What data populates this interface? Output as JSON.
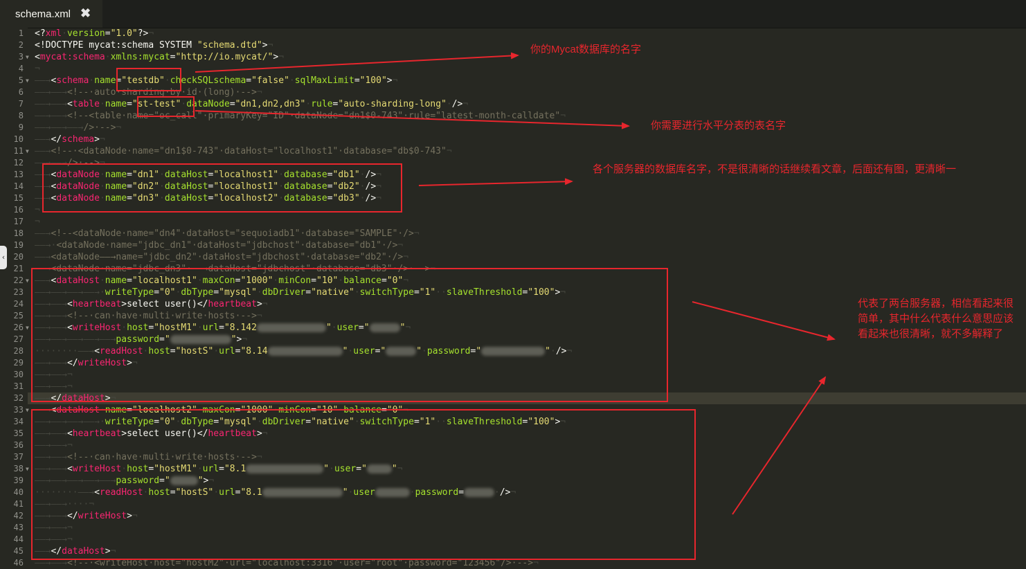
{
  "tab": {
    "title": "schema.xml",
    "close": "✖"
  },
  "colors": {
    "tag": "#f92672",
    "attr": "#a6e22e",
    "string": "#e6db74",
    "comment": "#75715e",
    "annotation": "#e8262d"
  },
  "code": [
    [
      [
        "p",
        "<?"
      ],
      [
        "t",
        "xml"
      ],
      [
        "w",
        "·"
      ],
      [
        "a",
        "version"
      ],
      [
        "p",
        "="
      ],
      [
        "s",
        "\"1.0\""
      ],
      [
        "p",
        "?>"
      ],
      [
        "w",
        "¬"
      ]
    ],
    [
      [
        "p",
        "<!DOCTYPE mycat:schema SYSTEM "
      ],
      [
        "s",
        "\"schema.dtd\""
      ],
      [
        "p",
        ">"
      ],
      [
        "w",
        "¬"
      ]
    ],
    [
      [
        "p",
        "<"
      ],
      [
        "t",
        "mycat:schema"
      ],
      [
        "w",
        "·"
      ],
      [
        "a",
        "xmlns:mycat"
      ],
      [
        "p",
        "="
      ],
      [
        "s",
        "\"http://io.mycat/\""
      ],
      [
        "p",
        ">"
      ],
      [
        "w",
        "¬"
      ]
    ],
    [
      [
        "w",
        "¬"
      ]
    ],
    [
      [
        "w",
        "——→"
      ],
      [
        "p",
        "<"
      ],
      [
        "t",
        "schema"
      ],
      [
        "w",
        "·"
      ],
      [
        "a",
        "name"
      ],
      [
        "p",
        "="
      ],
      [
        "s",
        "\"testdb\""
      ],
      [
        "w",
        "·"
      ],
      [
        "a",
        "checkSQLschema"
      ],
      [
        "p",
        "="
      ],
      [
        "s",
        "\"false\""
      ],
      [
        "w",
        "·"
      ],
      [
        "a",
        "sqlMaxLimit"
      ],
      [
        "p",
        "="
      ],
      [
        "s",
        "\"100\""
      ],
      [
        "p",
        ">"
      ],
      [
        "w",
        "¬"
      ]
    ],
    [
      [
        "w",
        "——→——→"
      ],
      [
        "c",
        "<!--·auto·sharding·by·id·(long)·-->"
      ],
      [
        "w",
        "¬"
      ]
    ],
    [
      [
        "w",
        "——→——→"
      ],
      [
        "p",
        "<"
      ],
      [
        "t",
        "table"
      ],
      [
        "w",
        "·"
      ],
      [
        "a",
        "name"
      ],
      [
        "p",
        "="
      ],
      [
        "s",
        "\"st-test\""
      ],
      [
        "w",
        "·"
      ],
      [
        "a",
        "dataNode"
      ],
      [
        "p",
        "="
      ],
      [
        "s",
        "\"dn1,dn2,dn3\""
      ],
      [
        "w",
        "·"
      ],
      [
        "a",
        "rule"
      ],
      [
        "p",
        "="
      ],
      [
        "s",
        "\"auto-sharding-long\""
      ],
      [
        "w",
        "·"
      ],
      [
        "p",
        "/>"
      ],
      [
        "w",
        "¬"
      ]
    ],
    [
      [
        "w",
        "——→——→"
      ],
      [
        "c",
        "<!--<table·name=\"oc_call\"·primaryKey=\"ID\"·dataNode=\"dn1$0-743\"·rule=\"latest-month-calldate\""
      ],
      [
        "w",
        "¬"
      ]
    ],
    [
      [
        "w",
        "——→——→——→"
      ],
      [
        "c",
        "/>·-->"
      ],
      [
        "w",
        "¬"
      ]
    ],
    [
      [
        "w",
        "——→"
      ],
      [
        "p",
        "</"
      ],
      [
        "t",
        "schema"
      ],
      [
        "p",
        ">"
      ],
      [
        "w",
        "¬"
      ]
    ],
    [
      [
        "w",
        "——→"
      ],
      [
        "c",
        "<!--·<dataNode·name=\"dn1$0-743\"·dataHost=\"localhost1\"·database=\"db$0-743\""
      ],
      [
        "w",
        "¬"
      ]
    ],
    [
      [
        "w",
        "——→——→"
      ],
      [
        "c",
        "/>·-->"
      ],
      [
        "w",
        "¬"
      ]
    ],
    [
      [
        "w",
        "——→"
      ],
      [
        "p",
        "<"
      ],
      [
        "t",
        "dataNode"
      ],
      [
        "w",
        "·"
      ],
      [
        "a",
        "name"
      ],
      [
        "p",
        "="
      ],
      [
        "s",
        "\"dn1\""
      ],
      [
        "w",
        "·"
      ],
      [
        "a",
        "dataHost"
      ],
      [
        "p",
        "="
      ],
      [
        "s",
        "\"localhost1\""
      ],
      [
        "w",
        "·"
      ],
      [
        "a",
        "database"
      ],
      [
        "p",
        "="
      ],
      [
        "s",
        "\"db1\""
      ],
      [
        "w",
        "·"
      ],
      [
        "p",
        "/>"
      ],
      [
        "w",
        "¬"
      ]
    ],
    [
      [
        "w",
        "——→"
      ],
      [
        "p",
        "<"
      ],
      [
        "t",
        "dataNode"
      ],
      [
        "w",
        "·"
      ],
      [
        "a",
        "name"
      ],
      [
        "p",
        "="
      ],
      [
        "s",
        "\"dn2\""
      ],
      [
        "w",
        "·"
      ],
      [
        "a",
        "dataHost"
      ],
      [
        "p",
        "="
      ],
      [
        "s",
        "\"localhost1\""
      ],
      [
        "w",
        "·"
      ],
      [
        "a",
        "database"
      ],
      [
        "p",
        "="
      ],
      [
        "s",
        "\"db2\""
      ],
      [
        "w",
        "·"
      ],
      [
        "p",
        "/>"
      ],
      [
        "w",
        "¬"
      ]
    ],
    [
      [
        "w",
        "——→"
      ],
      [
        "p",
        "<"
      ],
      [
        "t",
        "dataNode"
      ],
      [
        "w",
        "·"
      ],
      [
        "a",
        "name"
      ],
      [
        "p",
        "="
      ],
      [
        "s",
        "\"dn3\""
      ],
      [
        "w",
        "·"
      ],
      [
        "a",
        "dataHost"
      ],
      [
        "p",
        "="
      ],
      [
        "s",
        "\"localhost2\""
      ],
      [
        "w",
        "·"
      ],
      [
        "a",
        "database"
      ],
      [
        "p",
        "="
      ],
      [
        "s",
        "\"db3\""
      ],
      [
        "w",
        "·"
      ],
      [
        "p",
        "/>"
      ],
      [
        "w",
        "¬"
      ]
    ],
    [
      [
        "w",
        "¬"
      ]
    ],
    [
      [
        "w",
        "¬"
      ]
    ],
    [
      [
        "w",
        "——→"
      ],
      [
        "c",
        "<!--<dataNode·name=\"dn4\"·dataHost=\"sequoiadb1\"·database=\"SAMPLE\"·/>"
      ],
      [
        "w",
        "¬"
      ]
    ],
    [
      [
        "w",
        "——→·"
      ],
      [
        "c",
        "<dataNode·name=\"jdbc_dn1\"·dataHost=\"jdbchost\"·database=\"db1\"·/>"
      ],
      [
        "w",
        "¬"
      ]
    ],
    [
      [
        "w",
        "——→"
      ],
      [
        "c",
        "<dataNode——→name=\"jdbc_dn2\"·dataHost=\"jdbchost\"·database=\"db2\"·/>"
      ],
      [
        "w",
        "¬"
      ]
    ],
    [
      [
        "w",
        "——→"
      ],
      [
        "c",
        "<dataNode·name=\"jdbc_dn3\"·——→dataHost=\"jdbchost\"·database=\"db3\"·/>·-->"
      ],
      [
        "w",
        "¬"
      ]
    ],
    [
      [
        "w",
        "——→"
      ],
      [
        "p",
        "<"
      ],
      [
        "t",
        "dataHost"
      ],
      [
        "w",
        "·"
      ],
      [
        "a",
        "name"
      ],
      [
        "p",
        "="
      ],
      [
        "s",
        "\"localhost1\""
      ],
      [
        "w",
        "·"
      ],
      [
        "a",
        "maxCon"
      ],
      [
        "p",
        "="
      ],
      [
        "s",
        "\"1000\""
      ],
      [
        "w",
        "·"
      ],
      [
        "a",
        "minCon"
      ],
      [
        "p",
        "="
      ],
      [
        "s",
        "\"10\""
      ],
      [
        "w",
        "·"
      ],
      [
        "a",
        "balance"
      ],
      [
        "p",
        "="
      ],
      [
        "s",
        "\"0\""
      ],
      [
        "w",
        "¬"
      ]
    ],
    [
      [
        "w",
        "——→——→——→——→·"
      ],
      [
        "a",
        "writeType"
      ],
      [
        "p",
        "="
      ],
      [
        "s",
        "\"0\""
      ],
      [
        "w",
        "·"
      ],
      [
        "a",
        "dbType"
      ],
      [
        "p",
        "="
      ],
      [
        "s",
        "\"mysql\""
      ],
      [
        "w",
        "·"
      ],
      [
        "a",
        "dbDriver"
      ],
      [
        "p",
        "="
      ],
      [
        "s",
        "\"native\""
      ],
      [
        "w",
        "·"
      ],
      [
        "a",
        "switchType"
      ],
      [
        "p",
        "="
      ],
      [
        "s",
        "\"1\""
      ],
      [
        "w",
        "··"
      ],
      [
        "a",
        "slaveThreshold"
      ],
      [
        "p",
        "="
      ],
      [
        "s",
        "\"100\""
      ],
      [
        "p",
        ">"
      ],
      [
        "w",
        "¬"
      ]
    ],
    [
      [
        "w",
        "——→——→"
      ],
      [
        "p",
        "<"
      ],
      [
        "t",
        "heartbeat"
      ],
      [
        "p",
        ">select user()</"
      ],
      [
        "t",
        "heartbeat"
      ],
      [
        "p",
        ">"
      ],
      [
        "w",
        "¬"
      ]
    ],
    [
      [
        "w",
        "——→——→"
      ],
      [
        "c",
        "<!--·can·have·multi·write·hosts·-->"
      ],
      [
        "w",
        "¬"
      ]
    ],
    [
      [
        "w",
        "——→——→"
      ],
      [
        "p",
        "<"
      ],
      [
        "t",
        "writeHost"
      ],
      [
        "w",
        "·"
      ],
      [
        "a",
        "host"
      ],
      [
        "p",
        "="
      ],
      [
        "s",
        "\"hostM1\""
      ],
      [
        "w",
        "·"
      ],
      [
        "a",
        "url"
      ],
      [
        "p",
        "="
      ],
      [
        "s",
        "\"8.142"
      ],
      [
        "B",
        "100"
      ],
      [
        "s",
        "\""
      ],
      [
        "w",
        "·"
      ],
      [
        "a",
        "user"
      ],
      [
        "p",
        "="
      ],
      [
        "s",
        "\""
      ],
      [
        "B",
        "44"
      ],
      [
        "s",
        "\""
      ],
      [
        "w",
        "¬"
      ]
    ],
    [
      [
        "w",
        "——→——→——→——→——→"
      ],
      [
        "a",
        "password"
      ],
      [
        "p",
        "="
      ],
      [
        "s",
        "\""
      ],
      [
        "B",
        "88"
      ],
      [
        "s",
        "\""
      ],
      [
        "p",
        ">"
      ],
      [
        "w",
        "¬"
      ]
    ],
    [
      [
        "w",
        "········——→"
      ],
      [
        "p",
        "<"
      ],
      [
        "t",
        "readHost"
      ],
      [
        "w",
        "·"
      ],
      [
        "a",
        "host"
      ],
      [
        "p",
        "="
      ],
      [
        "s",
        "\"hostS\""
      ],
      [
        "w",
        "·"
      ],
      [
        "a",
        "url"
      ],
      [
        "p",
        "="
      ],
      [
        "s",
        "\"8.14"
      ],
      [
        "B",
        "108"
      ],
      [
        "s",
        "\""
      ],
      [
        "w",
        "·"
      ],
      [
        "a",
        "user"
      ],
      [
        "p",
        "="
      ],
      [
        "s",
        "\""
      ],
      [
        "B",
        "44"
      ],
      [
        "s",
        "\""
      ],
      [
        "w",
        "·"
      ],
      [
        "a",
        "password"
      ],
      [
        "p",
        "="
      ],
      [
        "s",
        "\""
      ],
      [
        "B",
        "92"
      ],
      [
        "s",
        "\""
      ],
      [
        "w",
        "·"
      ],
      [
        "p",
        "/>"
      ],
      [
        "w",
        "¬"
      ]
    ],
    [
      [
        "w",
        "——→——→"
      ],
      [
        "p",
        "</"
      ],
      [
        "t",
        "writeHost"
      ],
      [
        "p",
        ">"
      ],
      [
        "w",
        "¬"
      ]
    ],
    [
      [
        "w",
        "——→——→"
      ],
      [
        "w",
        "¬"
      ]
    ],
    [
      [
        "w",
        "——→——→"
      ],
      [
        "w",
        "¬"
      ]
    ],
    [
      [
        "w",
        "——→"
      ],
      [
        "p",
        "</"
      ],
      [
        "t",
        "dataHost"
      ],
      [
        "p",
        ">"
      ],
      [
        "w",
        "¬"
      ]
    ],
    [
      [
        "w",
        "——→"
      ],
      [
        "p",
        "<"
      ],
      [
        "t",
        "dataHost"
      ],
      [
        "w",
        "·"
      ],
      [
        "a",
        "name"
      ],
      [
        "p",
        "="
      ],
      [
        "s",
        "\"localhost2\""
      ],
      [
        "w",
        "·"
      ],
      [
        "a",
        "maxCon"
      ],
      [
        "p",
        "="
      ],
      [
        "s",
        "\"1000\""
      ],
      [
        "w",
        "·"
      ],
      [
        "a",
        "minCon"
      ],
      [
        "p",
        "="
      ],
      [
        "s",
        "\"10\""
      ],
      [
        "w",
        "·"
      ],
      [
        "a",
        "balance"
      ],
      [
        "p",
        "="
      ],
      [
        "s",
        "\"0\""
      ],
      [
        "w",
        "¬"
      ]
    ],
    [
      [
        "w",
        "——→——→——→——→·"
      ],
      [
        "a",
        "writeType"
      ],
      [
        "p",
        "="
      ],
      [
        "s",
        "\"0\""
      ],
      [
        "w",
        "·"
      ],
      [
        "a",
        "dbType"
      ],
      [
        "p",
        "="
      ],
      [
        "s",
        "\"mysql\""
      ],
      [
        "w",
        "·"
      ],
      [
        "a",
        "dbDriver"
      ],
      [
        "p",
        "="
      ],
      [
        "s",
        "\"native\""
      ],
      [
        "w",
        "·"
      ],
      [
        "a",
        "switchType"
      ],
      [
        "p",
        "="
      ],
      [
        "s",
        "\"1\""
      ],
      [
        "w",
        "··"
      ],
      [
        "a",
        "slaveThreshold"
      ],
      [
        "p",
        "="
      ],
      [
        "s",
        "\"100\""
      ],
      [
        "p",
        ">"
      ],
      [
        "w",
        "¬"
      ]
    ],
    [
      [
        "w",
        "——→——→"
      ],
      [
        "p",
        "<"
      ],
      [
        "t",
        "heartbeat"
      ],
      [
        "p",
        ">select user()</"
      ],
      [
        "t",
        "heartbeat"
      ],
      [
        "p",
        ">"
      ],
      [
        "w",
        "¬"
      ]
    ],
    [
      [
        "w",
        "——→——→"
      ],
      [
        "w",
        "¬"
      ]
    ],
    [
      [
        "w",
        "——→——→"
      ],
      [
        "c",
        "<!--·can·have·multi·write·hosts·-->"
      ],
      [
        "w",
        "¬"
      ]
    ],
    [
      [
        "w",
        "——→——→"
      ],
      [
        "p",
        "<"
      ],
      [
        "t",
        "writeHost"
      ],
      [
        "w",
        "·"
      ],
      [
        "a",
        "host"
      ],
      [
        "p",
        "="
      ],
      [
        "s",
        "\"hostM1\""
      ],
      [
        "w",
        "·"
      ],
      [
        "a",
        "url"
      ],
      [
        "p",
        "="
      ],
      [
        "s",
        "\"8.1"
      ],
      [
        "B",
        "112"
      ],
      [
        "s",
        "\""
      ],
      [
        "w",
        "·"
      ],
      [
        "a",
        "user"
      ],
      [
        "p",
        "="
      ],
      [
        "s",
        "\""
      ],
      [
        "B",
        "36"
      ],
      [
        "s",
        "\""
      ],
      [
        "w",
        "¬"
      ]
    ],
    [
      [
        "w",
        "——→——→——→——→——→"
      ],
      [
        "a",
        "password"
      ],
      [
        "p",
        "="
      ],
      [
        "s",
        "\""
      ],
      [
        "B",
        "40"
      ],
      [
        "s",
        "\""
      ],
      [
        "p",
        ">"
      ],
      [
        "w",
        "¬"
      ]
    ],
    [
      [
        "w",
        "········——→"
      ],
      [
        "p",
        "<"
      ],
      [
        "t",
        "readHost"
      ],
      [
        "w",
        "·"
      ],
      [
        "a",
        "host"
      ],
      [
        "p",
        "="
      ],
      [
        "s",
        "\"hostS\""
      ],
      [
        "w",
        "·"
      ],
      [
        "a",
        "url"
      ],
      [
        "p",
        "="
      ],
      [
        "s",
        "\"8.1"
      ],
      [
        "B",
        "116"
      ],
      [
        "s",
        "\""
      ],
      [
        "w",
        "·"
      ],
      [
        "a",
        "user"
      ],
      [
        "B",
        "50"
      ],
      [
        "w",
        "·"
      ],
      [
        "a",
        "password"
      ],
      [
        "p",
        "="
      ],
      [
        "B",
        "44"
      ],
      [
        "w",
        "·"
      ],
      [
        "p",
        "/>"
      ],
      [
        "w",
        "¬"
      ]
    ],
    [
      [
        "w",
        "——→——→····"
      ],
      [
        "w",
        "¬"
      ]
    ],
    [
      [
        "w",
        "——→——→"
      ],
      [
        "p",
        "</"
      ],
      [
        "t",
        "writeHost"
      ],
      [
        "p",
        ">"
      ],
      [
        "w",
        "¬"
      ]
    ],
    [
      [
        "w",
        "——→——→"
      ],
      [
        "w",
        "¬"
      ]
    ],
    [
      [
        "w",
        "——→——→"
      ],
      [
        "w",
        "¬"
      ]
    ],
    [
      [
        "w",
        "——→"
      ],
      [
        "p",
        "</"
      ],
      [
        "t",
        "dataHost"
      ],
      [
        "p",
        ">"
      ],
      [
        "w",
        "¬"
      ]
    ],
    [
      [
        "w",
        "——→——→"
      ],
      [
        "c",
        "<!--·<writeHost·host=\"hostM2\"·url=\"localhost:3316\"·user=\"root\"·password=\"123456\"/>·-->"
      ],
      [
        "w",
        "¬"
      ]
    ]
  ],
  "fold_lines": [
    3,
    5,
    11,
    22,
    26,
    33,
    38
  ],
  "current_line": 32,
  "annotations": {
    "db_name": "你的Mycat数据库的名字",
    "table_name": "你需要进行水平分表的表名字",
    "node_db": "各个服务器的数据库名字，不是很清晰的话继续看文章，后面还有图，更清晰一",
    "servers": "代表了两台服务器，相信看起来很简单，其中什么代表什么意思应该看起来也很清晰，就不多解释了"
  }
}
